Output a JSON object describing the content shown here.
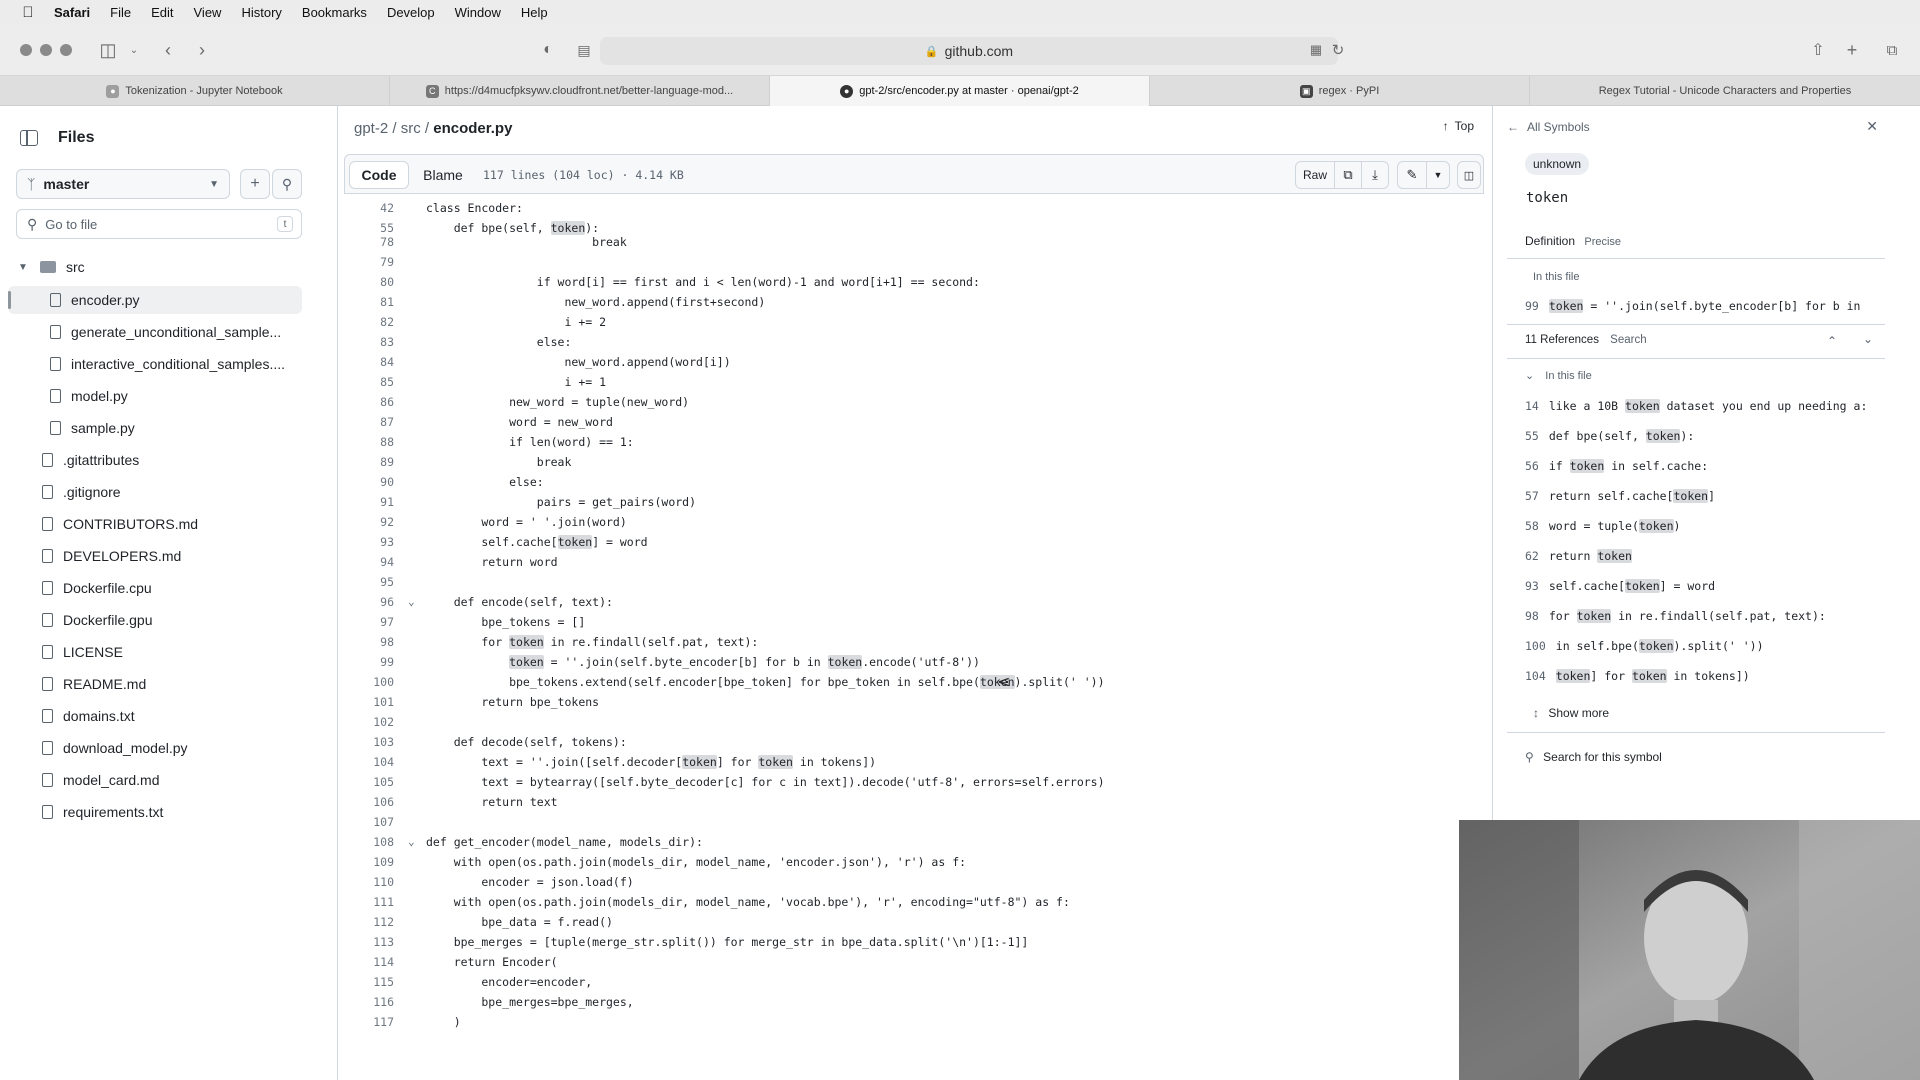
{
  "menubar": {
    "app": "Safari",
    "items": [
      "File",
      "Edit",
      "View",
      "History",
      "Bookmarks",
      "Develop",
      "Window",
      "Help"
    ]
  },
  "browser": {
    "url": "github.com"
  },
  "tabs": [
    {
      "title": "Tokenization - Jupyter Notebook",
      "icon": "jupyter-icon"
    },
    {
      "title": "https://d4mucfpksywv.cloudfront.net/better-language-mod...",
      "icon": "link-icon"
    },
    {
      "title": "gpt-2/src/encoder.py at master · openai/gpt-2",
      "icon": "github-icon"
    },
    {
      "title": "regex · PyPI",
      "icon": "pypi-icon"
    },
    {
      "title": "Regex Tutorial - Unicode Characters and Properties",
      "icon": ""
    }
  ],
  "sidebar": {
    "title": "Files",
    "branch": "master",
    "goto_placeholder": "Go to file",
    "goto_shortcut": "t",
    "folder": "src",
    "src_files": [
      "encoder.py",
      "generate_unconditional_sample...",
      "interactive_conditional_samples....",
      "model.py",
      "sample.py"
    ],
    "root_files": [
      ".gitattributes",
      ".gitignore",
      "CONTRIBUTORS.md",
      "DEVELOPERS.md",
      "Dockerfile.cpu",
      "Dockerfile.gpu",
      "LICENSE",
      "README.md",
      "domains.txt",
      "download_model.py",
      "model_card.md",
      "requirements.txt"
    ]
  },
  "file": {
    "crumb_repo": "gpt-2",
    "crumb_sep1": " / ",
    "crumb_dir": "src",
    "crumb_sep2": " / ",
    "crumb_file": "encoder.py",
    "top_label": "Top",
    "tab_code": "Code",
    "tab_blame": "Blame",
    "info": "117 lines (104 loc) · 4.14 KB",
    "raw_label": "Raw"
  },
  "code_lines": [
    {
      "n": "42",
      "t": "class Encoder:"
    },
    {
      "n": "55",
      "t": "    def bpe(self, token):"
    },
    {
      "n": "78",
      "t": "                        break"
    },
    {
      "n": "79",
      "t": ""
    },
    {
      "n": "80",
      "t": "                if word[i] == first and i < len(word)-1 and word[i+1] == second:"
    },
    {
      "n": "81",
      "t": "                    new_word.append(first+second)"
    },
    {
      "n": "82",
      "t": "                    i += 2"
    },
    {
      "n": "83",
      "t": "                else:"
    },
    {
      "n": "84",
      "t": "                    new_word.append(word[i])"
    },
    {
      "n": "85",
      "t": "                    i += 1"
    },
    {
      "n": "86",
      "t": "            new_word = tuple(new_word)"
    },
    {
      "n": "87",
      "t": "            word = new_word"
    },
    {
      "n": "88",
      "t": "            if len(word) == 1:"
    },
    {
      "n": "89",
      "t": "                break"
    },
    {
      "n": "90",
      "t": "            else:"
    },
    {
      "n": "91",
      "t": "                pairs = get_pairs(word)"
    },
    {
      "n": "92",
      "t": "        word = ' '.join(word)"
    },
    {
      "n": "93",
      "t": "        self.cache[token] = word"
    },
    {
      "n": "94",
      "t": "        return word"
    },
    {
      "n": "95",
      "t": ""
    },
    {
      "n": "96",
      "t": "    def encode(self, text):"
    },
    {
      "n": "97",
      "t": "        bpe_tokens = []"
    },
    {
      "n": "98",
      "t": "        for token in re.findall(self.pat, text):"
    },
    {
      "n": "99",
      "t": "            token = ''.join(self.byte_encoder[b] for b in token.encode('utf-8'))"
    },
    {
      "n": "100",
      "t": "            bpe_tokens.extend(self.encoder[bpe_token] for bpe_token in self.bpe(token).split(' '))"
    },
    {
      "n": "101",
      "t": "        return bpe_tokens"
    },
    {
      "n": "102",
      "t": ""
    },
    {
      "n": "103",
      "t": "    def decode(self, tokens):"
    },
    {
      "n": "104",
      "t": "        text = ''.join([self.decoder[token] for token in tokens])"
    },
    {
      "n": "105",
      "t": "        text = bytearray([self.byte_decoder[c] for c in text]).decode('utf-8', errors=self.errors)"
    },
    {
      "n": "106",
      "t": "        return text"
    },
    {
      "n": "107",
      "t": ""
    },
    {
      "n": "108",
      "t": "def get_encoder(model_name, models_dir):"
    },
    {
      "n": "109",
      "t": "    with open(os.path.join(models_dir, model_name, 'encoder.json'), 'r') as f:"
    },
    {
      "n": "110",
      "t": "        encoder = json.load(f)"
    },
    {
      "n": "111",
      "t": "    with open(os.path.join(models_dir, model_name, 'vocab.bpe'), 'r', encoding=\"utf-8\") as f:"
    },
    {
      "n": "112",
      "t": "        bpe_data = f.read()"
    },
    {
      "n": "113",
      "t": "    bpe_merges = [tuple(merge_str.split()) for merge_str in bpe_data.split('\\n')[1:-1]]"
    },
    {
      "n": "114",
      "t": "    return Encoder("
    },
    {
      "n": "115",
      "t": "        encoder=encoder,"
    },
    {
      "n": "116",
      "t": "        bpe_merges=bpe_merges,"
    },
    {
      "n": "117",
      "t": "    )"
    }
  ],
  "symbols": {
    "header": "All Symbols",
    "kind": "unknown",
    "name": "token",
    "definition_label": "Definition",
    "precise_label": "Precise",
    "in_this_file": "In this file",
    "definition_line": {
      "n": "99",
      "t": "token = ''.join(self.byte_encoder[b] for b in"
    },
    "references_label": "11 References",
    "search_label": "Search",
    "ref_group": "In this file",
    "references": [
      {
        "n": "14",
        "t": "like a 10B token dataset you end up needing a:"
      },
      {
        "n": "55",
        "t": "def bpe(self, token):"
      },
      {
        "n": "56",
        "t": "if token in self.cache:"
      },
      {
        "n": "57",
        "t": "return self.cache[token]"
      },
      {
        "n": "58",
        "t": "word = tuple(token)"
      },
      {
        "n": "62",
        "t": "return token"
      },
      {
        "n": "93",
        "t": "self.cache[token] = word"
      },
      {
        "n": "98",
        "t": "for token in re.findall(self.pat, text):"
      },
      {
        "n": "100",
        "t": "in self.bpe(token).split(' '))"
      },
      {
        "n": "104",
        "t": "token] for token in tokens])"
      }
    ],
    "show_more": "Show more",
    "search_symbol": "Search for this symbol"
  }
}
